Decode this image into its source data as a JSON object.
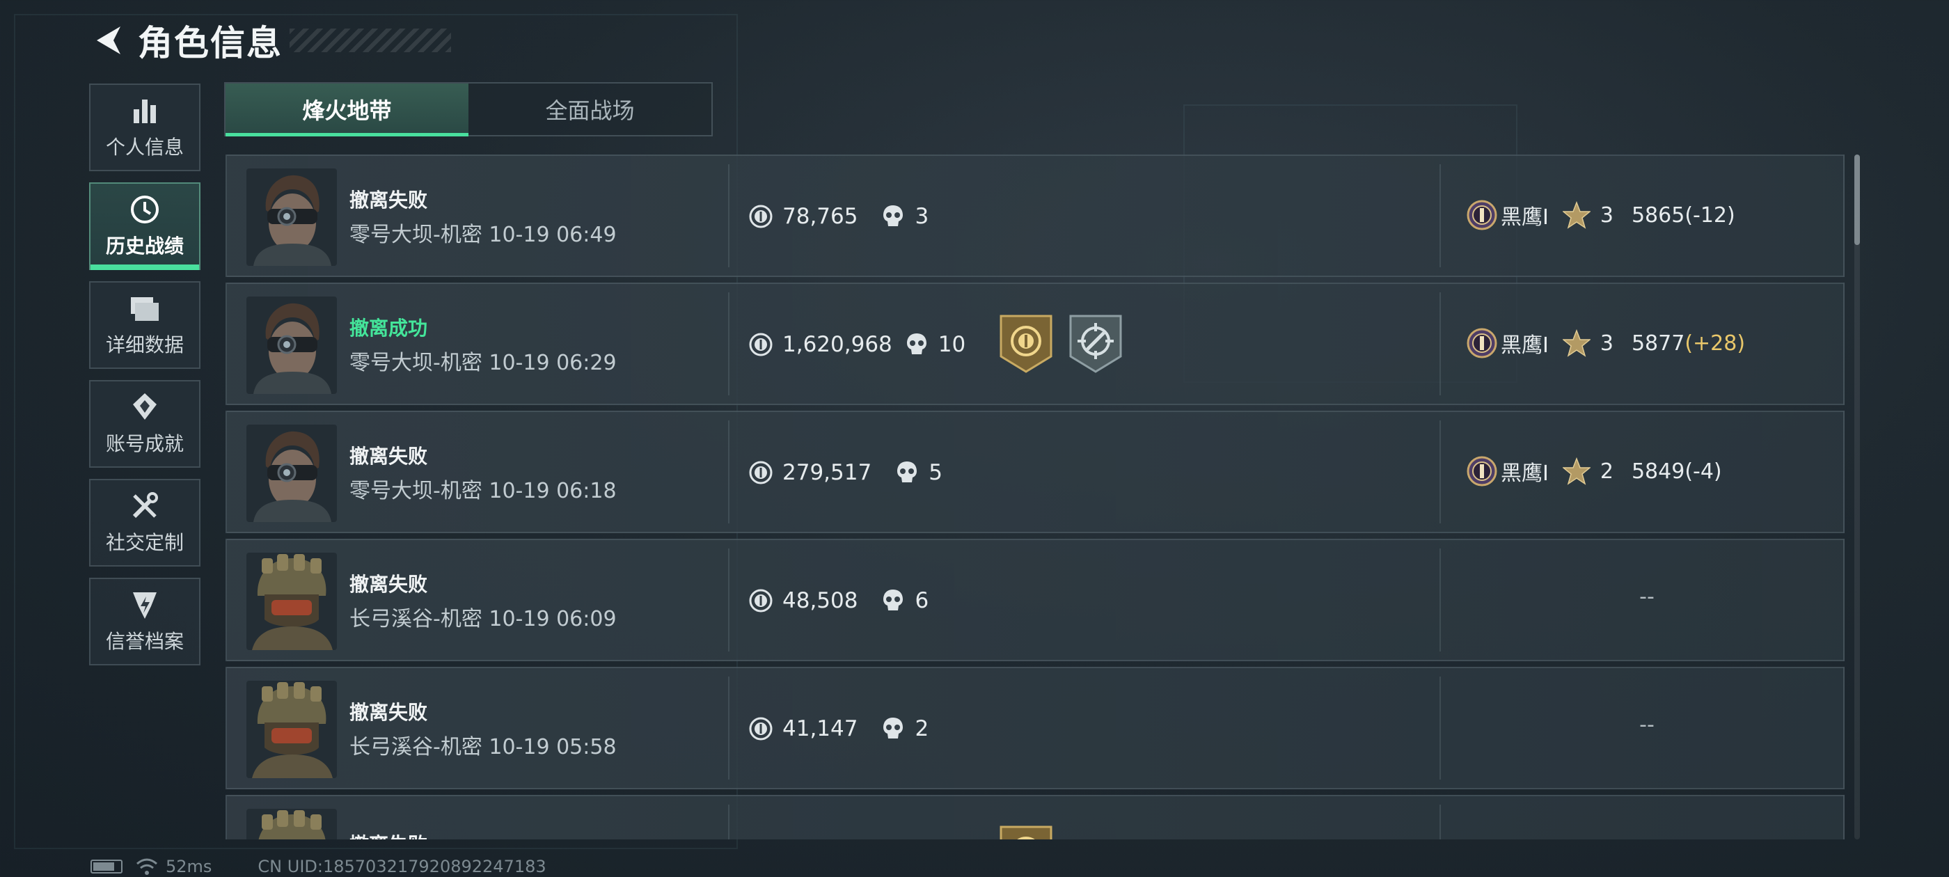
{
  "header": {
    "title": "角色信息",
    "back_icon": "back-arrow-icon"
  },
  "sidebar": {
    "items": [
      {
        "label": "个人信息",
        "icon": "bar-chart-icon",
        "active": false
      },
      {
        "label": "历史战绩",
        "icon": "clock-history-icon",
        "active": true
      },
      {
        "label": "详细数据",
        "icon": "folder-stack-icon",
        "active": false
      },
      {
        "label": "账号成就",
        "icon": "achievement-icon",
        "active": false
      },
      {
        "label": "社交定制",
        "icon": "tools-icon",
        "active": false
      },
      {
        "label": "信誉档案",
        "icon": "credit-icon",
        "active": false
      }
    ]
  },
  "tabs": [
    {
      "label": "烽火地带",
      "active": true
    },
    {
      "label": "全面战场",
      "active": false
    }
  ],
  "matches": [
    {
      "status": "撤离失败",
      "success": false,
      "map": "零号大坝-机密 10-19 06:49",
      "value": "78,765",
      "kills": "3",
      "badges": [],
      "rank_name": "黑鹰I",
      "stars": "3",
      "score": "5865",
      "delta": "(-12)",
      "delta_positive": false,
      "avatar": "soldier-goggles"
    },
    {
      "status": "撤离成功",
      "success": true,
      "map": "零号大坝-机密 10-19 06:29",
      "value": "1,620,968",
      "kills": "10",
      "badges": [
        "gold-coin-badge-icon",
        "crosshair-badge-icon"
      ],
      "rank_name": "黑鹰I",
      "stars": "3",
      "score": "5877",
      "delta": "(+28)",
      "delta_positive": true,
      "avatar": "soldier-goggles"
    },
    {
      "status": "撤离失败",
      "success": false,
      "map": "零号大坝-机密 10-19 06:18",
      "value": "279,517",
      "kills": "5",
      "badges": [],
      "rank_name": "黑鹰I",
      "stars": "2",
      "score": "5849",
      "delta": "(-4)",
      "delta_positive": false,
      "avatar": "soldier-goggles"
    },
    {
      "status": "撤离失败",
      "success": false,
      "map": "长弓溪谷-机密 10-19 06:09",
      "value": "48,508",
      "kills": "6",
      "badges": [],
      "rank_name": "",
      "stars": "",
      "score": "",
      "delta": "",
      "nodata": "--",
      "avatar": "soldier-helmet"
    },
    {
      "status": "撤离失败",
      "success": false,
      "map": "长弓溪谷-机密 10-19 05:58",
      "value": "41,147",
      "kills": "2",
      "badges": [],
      "rank_name": "",
      "stars": "",
      "score": "",
      "delta": "",
      "nodata": "--",
      "avatar": "soldier-helmet"
    },
    {
      "status": "撤离失败",
      "success": false,
      "map": "",
      "value": "",
      "kills": "",
      "badges": [
        "gold-coin-badge-icon"
      ],
      "rank_name": "",
      "stars": "",
      "score": "",
      "delta": "",
      "avatar": "soldier-helmet"
    }
  ],
  "footer": {
    "ping": "52ms",
    "uid": "CN UID:185703217920892247183"
  },
  "colors": {
    "accent": "#49e09e",
    "success": "#44e59a",
    "gain": "#e9c76a"
  }
}
